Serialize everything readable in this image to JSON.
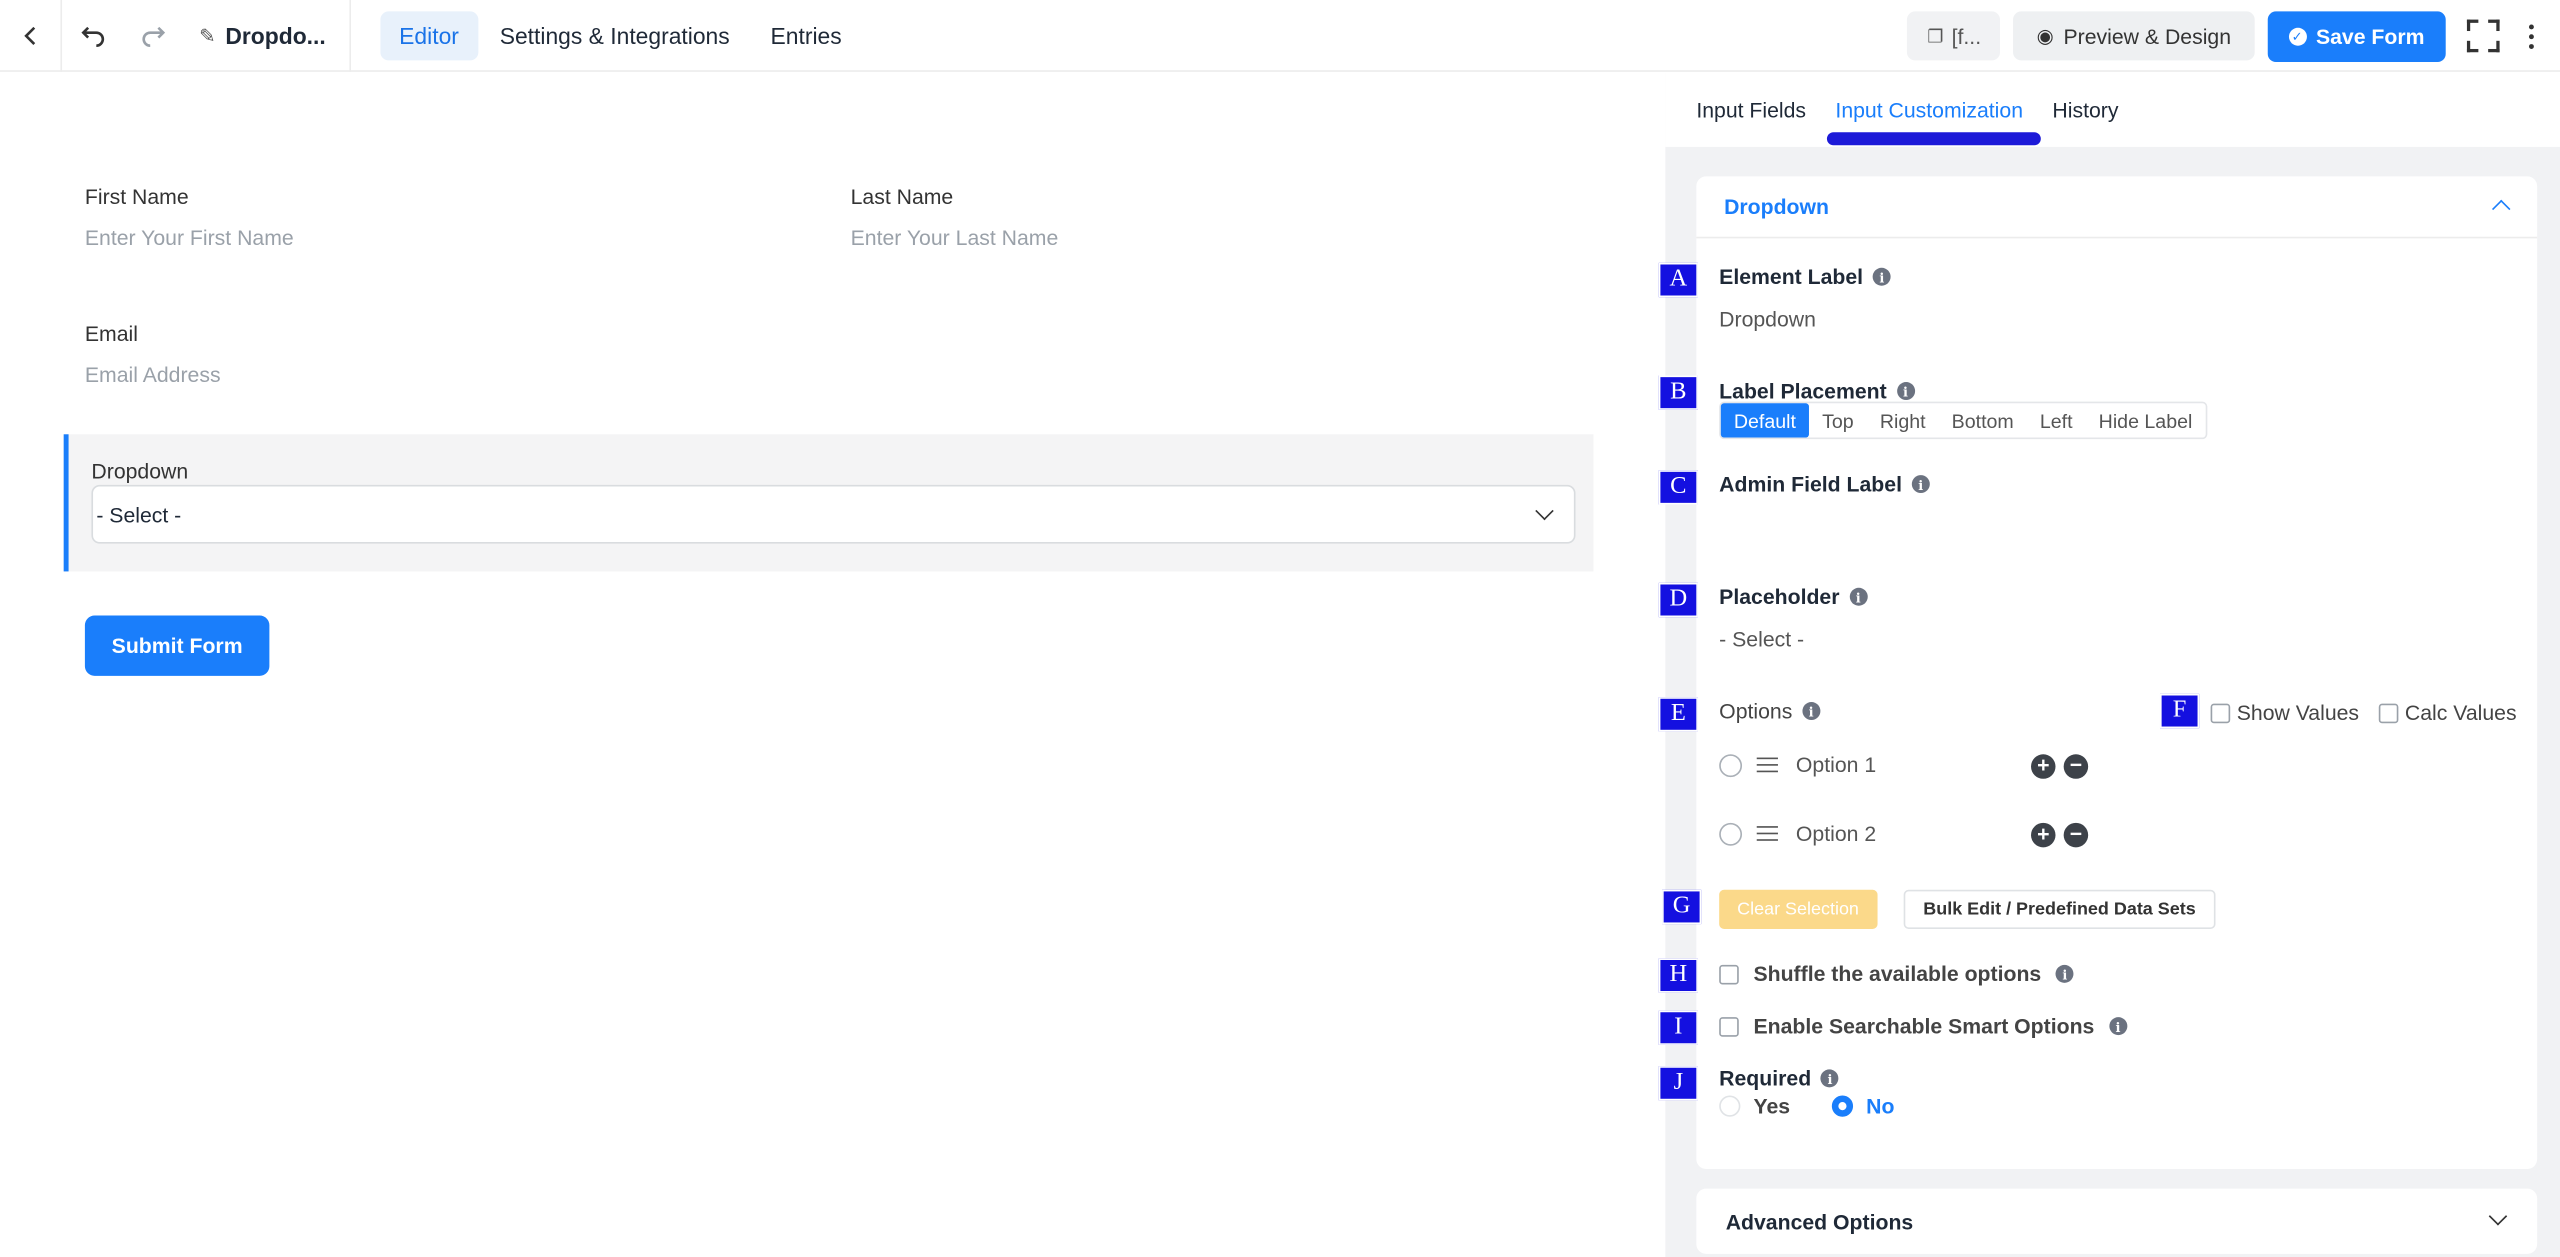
{
  "topbar": {
    "form_name": "Dropdo...",
    "nav": [
      "Editor",
      "Settings & Integrations",
      "Entries"
    ],
    "shortcode": "[f...",
    "preview_label": "Preview & Design",
    "save_label": "Save Form"
  },
  "canvas": {
    "first_name_label": "First Name",
    "first_name_placeholder": "Enter Your First Name",
    "last_name_label": "Last Name",
    "last_name_placeholder": "Enter Your Last Name",
    "email_label": "Email",
    "email_placeholder": "Email Address",
    "dropdown_label": "Dropdown",
    "dropdown_value": "- Select -",
    "submit_label": "Submit Form"
  },
  "panel": {
    "tabs": [
      "Input Fields",
      "Input Customization",
      "History"
    ],
    "section_title": "Dropdown",
    "element_label_title": "Element Label",
    "element_label_value": "Dropdown",
    "label_placement_title": "Label Placement",
    "placements": [
      "Default",
      "Top",
      "Right",
      "Bottom",
      "Left",
      "Hide Label"
    ],
    "admin_field_label_title": "Admin Field Label",
    "placeholder_title": "Placeholder",
    "placeholder_value": "- Select -",
    "options_title": "Options",
    "show_values": "Show Values",
    "calc_values": "Calc Values",
    "options": [
      "Option 1",
      "Option 2"
    ],
    "clear_selection": "Clear Selection",
    "bulk_edit": "Bulk Edit / Predefined Data Sets",
    "shuffle": "Shuffle the available options",
    "searchable": "Enable Searchable Smart Options",
    "required_title": "Required",
    "required_yes": "Yes",
    "required_no": "No",
    "advanced": "Advanced Options"
  },
  "badges": [
    "A",
    "B",
    "C",
    "D",
    "E",
    "F",
    "G",
    "H",
    "I",
    "J"
  ],
  "colors": {
    "accent": "#1a7efb",
    "badge": "#1410e0",
    "panel_bg": "#f1f2f4"
  }
}
